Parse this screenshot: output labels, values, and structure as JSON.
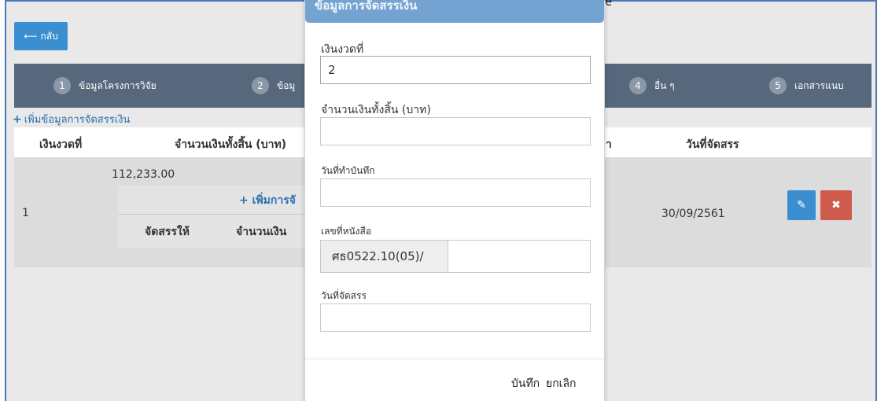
{
  "page": {
    "back_label": "กลับ",
    "close_label": "Close"
  },
  "steps": [
    {
      "num": "1",
      "label": "ข้อมูลโครงการวิจัย"
    },
    {
      "num": "2",
      "label": "ข้อมู"
    },
    {
      "num": "4",
      "label": "อื่น ๆ"
    },
    {
      "num": "5",
      "label": "เอกสารแนบ"
    }
  ],
  "add_link": "เพิ่มข้อมูลการจัดสรรเงิน",
  "table": {
    "headers": [
      "เงินงวดที่",
      "จำนวนเงินทั้งสิ้น (บาท)",
      "า",
      "วันที่จัดสรร"
    ],
    "rows": [
      {
        "no": "1",
        "amount": "112,233.00",
        "date": "30/09/2561",
        "sub_add": "เพิ่มการจั",
        "sub_headers": [
          "จัดสรรให้",
          "จำนวนเงิน"
        ]
      }
    ]
  },
  "modal": {
    "title": "ข้อมูลการจัดสรรเงิน",
    "fields": {
      "installment_label": "เงินงวดที่",
      "installment_value": "2",
      "total_label": "จำนวนเงินทั้งสิ้น (บาท)",
      "total_value": "",
      "record_date_label": "วันที่ทำบันทึก",
      "record_date_value": "",
      "doc_no_label": "เลขที่หนังสือ",
      "doc_no_prefix": "ศธ0522.10(05)/",
      "doc_no_value": "",
      "alloc_date_label": "วันที่จัดสรร",
      "alloc_date_value": ""
    },
    "save_label": "บันทึก",
    "cancel_label": "ยกเลิก"
  }
}
